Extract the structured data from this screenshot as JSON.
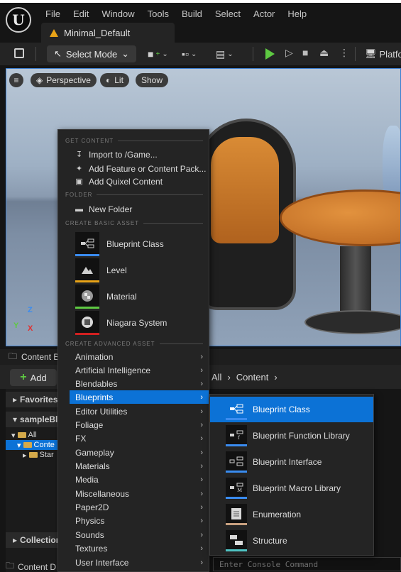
{
  "app": {
    "logo_text": "U",
    "menus": [
      "File",
      "Edit",
      "Window",
      "Tools",
      "Build",
      "Select",
      "Actor",
      "Help"
    ],
    "doc_tab": "Minimal_Default"
  },
  "toolbar": {
    "select_mode": "Select Mode",
    "platform": "Platfo"
  },
  "viewport": {
    "perspective": "Perspective",
    "lit": "Lit",
    "show": "Show",
    "axis_z": "Z",
    "axis_x": "X",
    "axis_y": "Y"
  },
  "content_browser": {
    "tab": "Content B",
    "add": "Add",
    "breadcrumb": [
      "All",
      "Content"
    ],
    "favorites": "Favorites",
    "project": "sampleBl",
    "tree": [
      "All",
      "Conte",
      "Star"
    ],
    "collections": "Collection",
    "bottom_tab": "Content D",
    "console_placeholder": "Enter Console Command"
  },
  "context_menu": {
    "sections": {
      "get_content": "GET CONTENT",
      "folder": "FOLDER",
      "basic": "CREATE BASIC ASSET",
      "advanced": "CREATE ADVANCED ASSET"
    },
    "get_content_items": [
      "Import to /Game...",
      "Add Feature or Content Pack...",
      "Add Quixel Content"
    ],
    "folder_items": [
      "New Folder"
    ],
    "basic_assets": [
      "Blueprint Class",
      "Level",
      "Material",
      "Niagara System"
    ],
    "advanced_assets": [
      "Animation",
      "Artificial Intelligence",
      "Blendables",
      "Blueprints",
      "Editor Utilities",
      "Foliage",
      "FX",
      "Gameplay",
      "Materials",
      "Media",
      "Miscellaneous",
      "Paper2D",
      "Physics",
      "Sounds",
      "Textures",
      "User Interface"
    ],
    "active_item": "Blueprints"
  },
  "submenu": {
    "items": [
      "Blueprint Class",
      "Blueprint Function Library",
      "Blueprint Interface",
      "Blueprint Macro Library",
      "Enumeration",
      "Structure"
    ],
    "active_item": "Blueprint Class"
  },
  "colors": {
    "accent_blue": "#0c72d6",
    "play_green": "#5ec942",
    "blueprint_line": "#3a8cf0",
    "level_line": "#e8a317",
    "material_line": "#5ec942",
    "niagara_line": "#d22020"
  }
}
